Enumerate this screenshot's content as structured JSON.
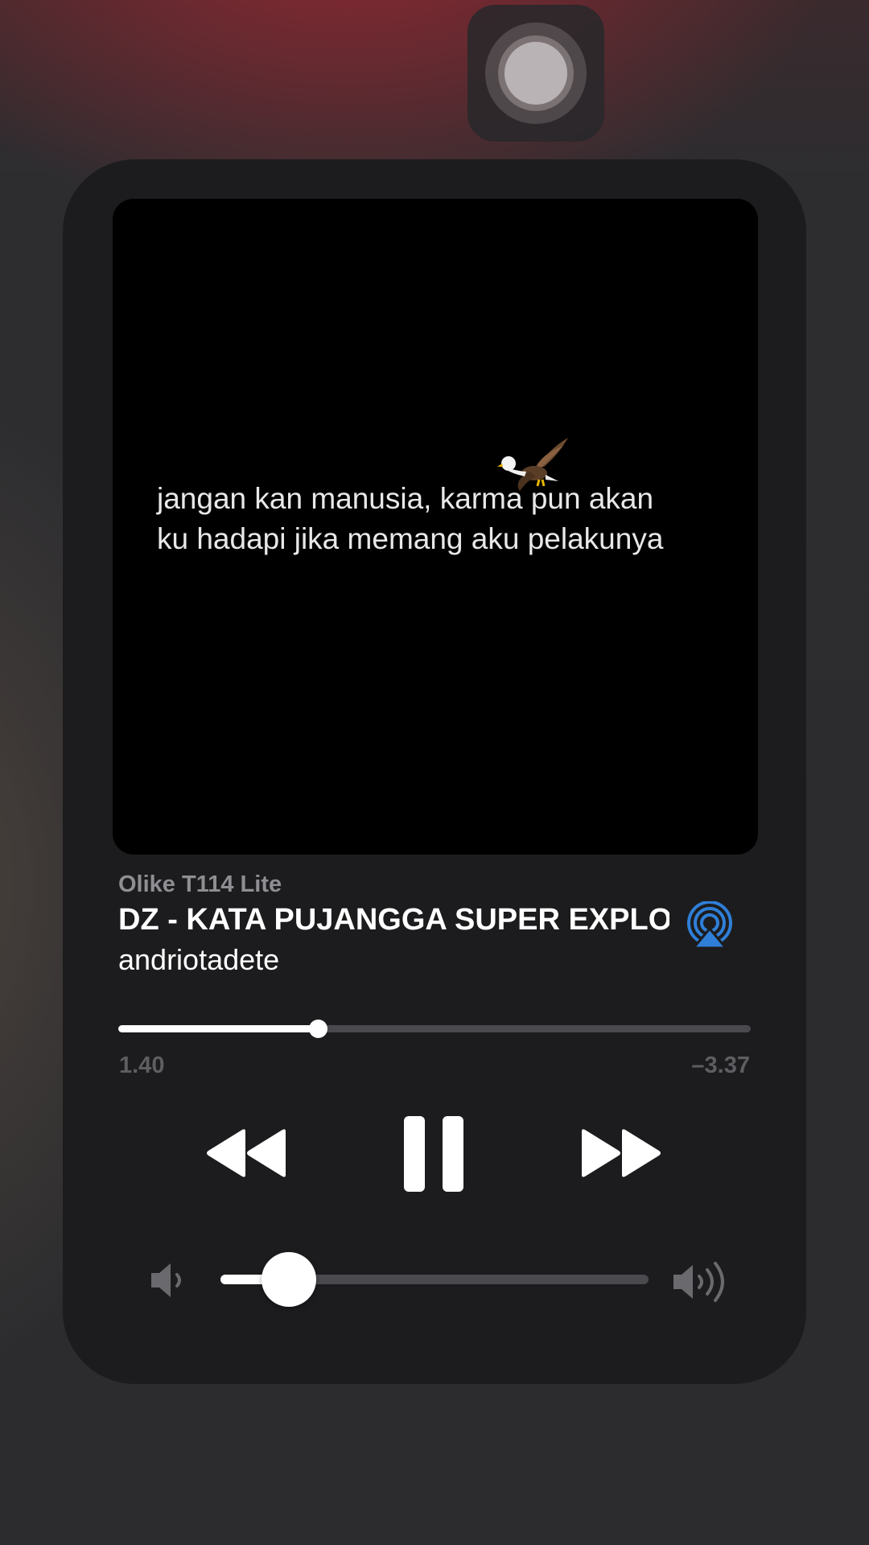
{
  "now_playing": {
    "lyric_text": "jangan kan manusia, karma pun akan\nku hadapi jika memang aku pelakunya",
    "device_name": "Olike T114 Lite",
    "title": "DZ - KATA PUJANGGA SUPER EXPLOSIVE",
    "artist": "andriotadete",
    "elapsed": "1.40",
    "remaining": "–3.37",
    "progress_fraction": 0.315,
    "volume_fraction": 0.16
  },
  "icons": {
    "airplay": "airplay-icon",
    "rewind": "rewind-icon",
    "pause": "pause-icon",
    "forward": "fast-forward-icon",
    "volume_low": "speaker-low-icon",
    "volume_high": "speaker-high-icon",
    "eagle": "eagle-emoji-icon"
  },
  "colors": {
    "accent_airplay": "#2f7fd8",
    "panel": "#1c1c1e",
    "track": "#4a4a4e"
  }
}
